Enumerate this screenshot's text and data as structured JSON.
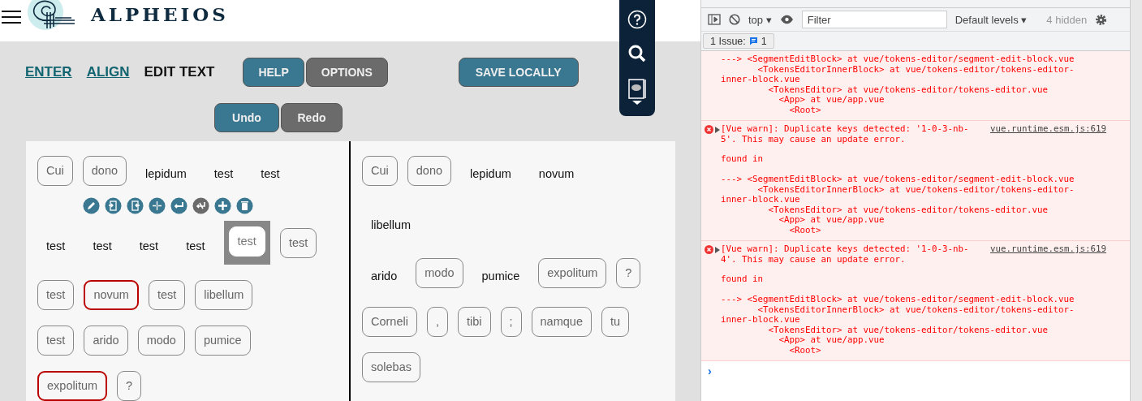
{
  "app": {
    "brand": "ALPHEIOS",
    "tabs": [
      {
        "label": "ENTER",
        "selected": false
      },
      {
        "label": "ALIGN",
        "selected": false
      },
      {
        "label": "EDIT TEXT",
        "selected": true
      }
    ],
    "buttons": [
      {
        "label": "HELP",
        "kind": "primary"
      },
      {
        "label": "OPTIONS",
        "kind": "secondary"
      },
      {
        "label": "SAVE LOCALLY",
        "kind": "primary"
      }
    ],
    "history_buttons": [
      {
        "label": "Undo",
        "kind": "primary"
      },
      {
        "label": "Redo",
        "kind": "secondary"
      }
    ],
    "side_toolbar": [
      {
        "kind": "help"
      },
      {
        "kind": "search"
      },
      {
        "kind": "book"
      }
    ],
    "editor": {
      "source": [
        {
          "kind": "tokens",
          "tokens": [
            {
              "text": "Cui",
              "kind": "boxed"
            },
            {
              "text": "dono",
              "kind": "boxed"
            },
            {
              "text": "lepidum",
              "kind": "plain"
            },
            {
              "text": "test",
              "kind": "plain"
            },
            {
              "text": "test",
              "kind": "plain"
            }
          ]
        },
        {
          "kind": "actions",
          "actions": [
            {
              "kind": "edit",
              "disabled": false
            },
            {
              "kind": "merge-left",
              "disabled": false
            },
            {
              "kind": "merge-right",
              "disabled": false
            },
            {
              "kind": "split",
              "disabled": false
            },
            {
              "kind": "new-line",
              "disabled": false
            },
            {
              "kind": "remove-line",
              "disabled": true
            },
            {
              "kind": "add",
              "disabled": false
            },
            {
              "kind": "delete",
              "disabled": false
            }
          ]
        },
        {
          "kind": "tokens",
          "tokens": [
            {
              "text": "test",
              "kind": "plain"
            },
            {
              "text": "test",
              "kind": "plain"
            },
            {
              "text": "test",
              "kind": "plain"
            },
            {
              "text": "test",
              "kind": "plain"
            },
            {
              "text": "test",
              "kind": "selected"
            },
            {
              "text": "test",
              "kind": "boxed"
            }
          ]
        },
        {
          "kind": "tokens",
          "tokens": [
            {
              "text": "test",
              "kind": "boxed"
            },
            {
              "text": "novum",
              "kind": "error"
            },
            {
              "text": "test",
              "kind": "boxed"
            },
            {
              "text": "libellum",
              "kind": "boxed"
            }
          ]
        },
        {
          "kind": "tokens",
          "tokens": [
            {
              "text": "test",
              "kind": "boxed"
            },
            {
              "text": "arido",
              "kind": "boxed"
            },
            {
              "text": "modo",
              "kind": "boxed"
            },
            {
              "text": "pumice",
              "kind": "boxed"
            }
          ]
        },
        {
          "kind": "tokens",
          "tokens": [
            {
              "text": "expolitum",
              "kind": "error"
            },
            {
              "text": "?",
              "kind": "boxed"
            }
          ]
        }
      ],
      "target": [
        {
          "kind": "tokens",
          "tokens": [
            {
              "text": "Cui",
              "kind": "boxed"
            },
            {
              "text": "dono",
              "kind": "boxed"
            },
            {
              "text": "lepidum",
              "kind": "plain"
            },
            {
              "text": "novum",
              "kind": "plain"
            }
          ]
        },
        {
          "kind": "tokens",
          "tokens": [
            {
              "text": "libellum",
              "kind": "plain"
            }
          ]
        },
        {
          "kind": "tokens",
          "tokens": [
            {
              "text": "arido",
              "kind": "plain"
            },
            {
              "text": "modo",
              "kind": "boxed"
            },
            {
              "text": "pumice",
              "kind": "plain"
            },
            {
              "text": "expolitum",
              "kind": "boxed"
            },
            {
              "text": "?",
              "kind": "boxed"
            }
          ]
        },
        {
          "kind": "tokens",
          "tokens": [
            {
              "text": "Corneli",
              "kind": "boxed"
            },
            {
              "text": ",",
              "kind": "boxed"
            },
            {
              "text": "tibi",
              "kind": "boxed"
            },
            {
              "text": ";",
              "kind": "boxed"
            },
            {
              "text": "namque",
              "kind": "boxed"
            },
            {
              "text": "tu",
              "kind": "boxed"
            }
          ]
        },
        {
          "kind": "tokens",
          "tokens": [
            {
              "text": "solebas",
              "kind": "boxed"
            }
          ]
        }
      ]
    }
  },
  "devtools": {
    "context": "top ▾",
    "filter": {
      "placeholder": "Filter"
    },
    "levels": "Default levels ▾",
    "hidden": "4 hidden",
    "issues": {
      "label": "1 Issue:",
      "count": "1"
    },
    "messages": [
      {
        "kind": "continuation",
        "body": "---> <SegmentEditBlock> at vue/tokens-editor/segment-edit-block.vue\n       <TokensEditorInnerBlock> at vue/tokens-editor/tokens-editor-\ninner-block.vue\n         <TokensEditor> at vue/tokens-editor/tokens-editor.vue\n           <App> at vue/app.vue\n             <Root>"
      },
      {
        "kind": "error",
        "summary": "[Vue warn]: Duplicate keys detected: '1-0-3-nb-\n5'. This may cause an update error.",
        "source": "vue.runtime.esm.js:619",
        "body": "found in\n\n---> <SegmentEditBlock> at vue/tokens-editor/segment-edit-block.vue\n       <TokensEditorInnerBlock> at vue/tokens-editor/tokens-editor-\ninner-block.vue\n         <TokensEditor> at vue/tokens-editor/tokens-editor.vue\n           <App> at vue/app.vue\n             <Root>"
      },
      {
        "kind": "error",
        "summary": "[Vue warn]: Duplicate keys detected: '1-0-3-nb-\n4'. This may cause an update error.",
        "source": "vue.runtime.esm.js:619",
        "body": "found in\n\n---> <SegmentEditBlock> at vue/tokens-editor/segment-edit-block.vue\n       <TokensEditorInnerBlock> at vue/tokens-editor/tokens-editor-\ninner-block.vue\n         <TokensEditor> at vue/tokens-editor/tokens-editor.vue\n           <App> at vue/app.vue\n             <Root>"
      }
    ],
    "prompt": "›"
  }
}
